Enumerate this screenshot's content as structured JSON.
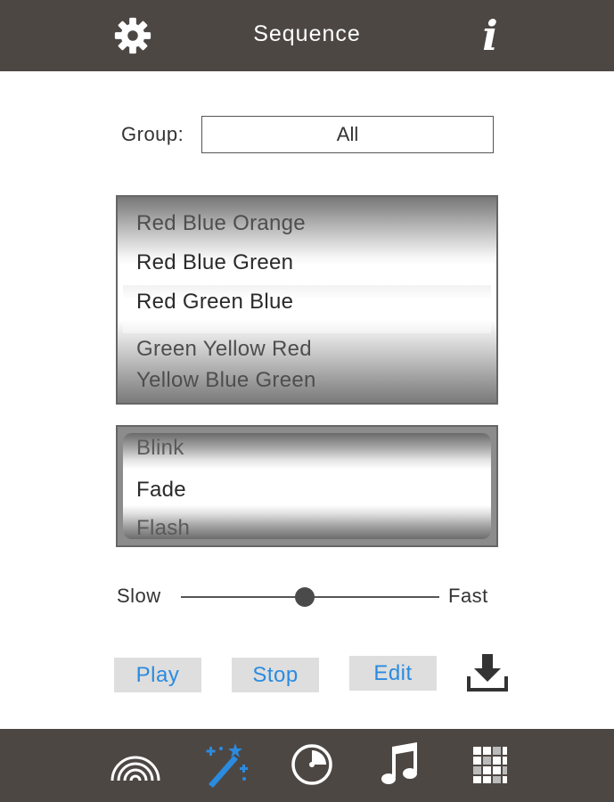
{
  "header": {
    "title": "Sequence",
    "left_icon": "gear-icon",
    "right_icon": "info-icon",
    "info_glyph": "i"
  },
  "group": {
    "label": "Group:",
    "value": "All"
  },
  "color_picker": {
    "items": [
      "Red Blue Orange",
      "Red Blue Green",
      "Red Green Blue",
      "Green Yellow Red",
      "Yellow Blue Green"
    ],
    "selected": "Red Green Blue"
  },
  "effect_picker": {
    "items": [
      "Blink",
      "Fade",
      "Flash"
    ],
    "selected": "Fade"
  },
  "speed": {
    "min_label": "Slow",
    "max_label": "Fast",
    "value": 0.48
  },
  "actions": {
    "play": "Play",
    "stop": "Stop",
    "edit": "Edit",
    "download_icon": "download-icon"
  },
  "tabs": [
    {
      "icon": "rainbow-icon",
      "active": false
    },
    {
      "icon": "magic-wand-icon",
      "active": true
    },
    {
      "icon": "timer-icon",
      "active": false
    },
    {
      "icon": "music-note-icon",
      "active": false
    },
    {
      "icon": "grid-icon",
      "active": false
    }
  ],
  "colors": {
    "bar": "#4d4744",
    "accent": "#2a8be0",
    "button_bg": "#dedede"
  }
}
